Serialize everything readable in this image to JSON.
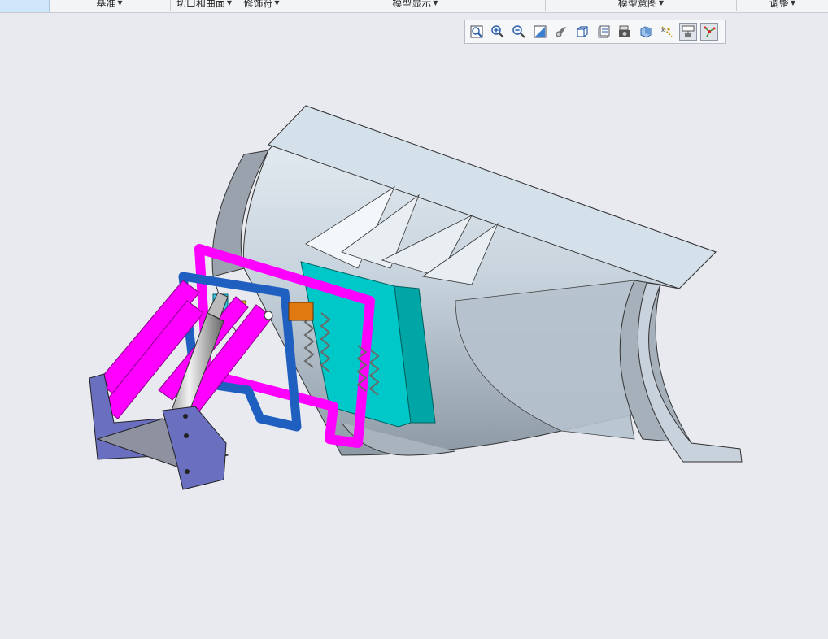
{
  "ribbon": {
    "groups": [
      {
        "label": "基准"
      },
      {
        "label": "切口和曲面"
      },
      {
        "label": "修饰符"
      },
      {
        "label": "模型显示"
      },
      {
        "label": "模型意图"
      },
      {
        "label": "调整"
      }
    ]
  },
  "view_toolbar": {
    "buttons": [
      {
        "icon": "refit-icon",
        "active": false
      },
      {
        "icon": "zoom-in-icon",
        "active": false
      },
      {
        "icon": "zoom-out-icon",
        "active": false
      },
      {
        "icon": "repaint-icon",
        "active": false
      },
      {
        "icon": "perspective-icon",
        "active": false
      },
      {
        "icon": "display-style-icon",
        "active": false
      },
      {
        "icon": "saved-orientations-icon",
        "active": false
      },
      {
        "icon": "view-manager-icon",
        "active": false
      },
      {
        "icon": "section-icon",
        "active": false
      },
      {
        "icon": "datum-display-icon",
        "active": false
      },
      {
        "icon": "annotation-display-icon",
        "active": true
      },
      {
        "icon": "spin-center-icon",
        "active": true
      }
    ]
  },
  "colors": {
    "background": "#e8eaef",
    "blade": "#c9d3dc",
    "frame_magenta": "#ff00ff",
    "frame_blue": "#1f5fc0",
    "plate_cyan": "#00c8c8",
    "mount_plate": "#6a6fc0"
  }
}
